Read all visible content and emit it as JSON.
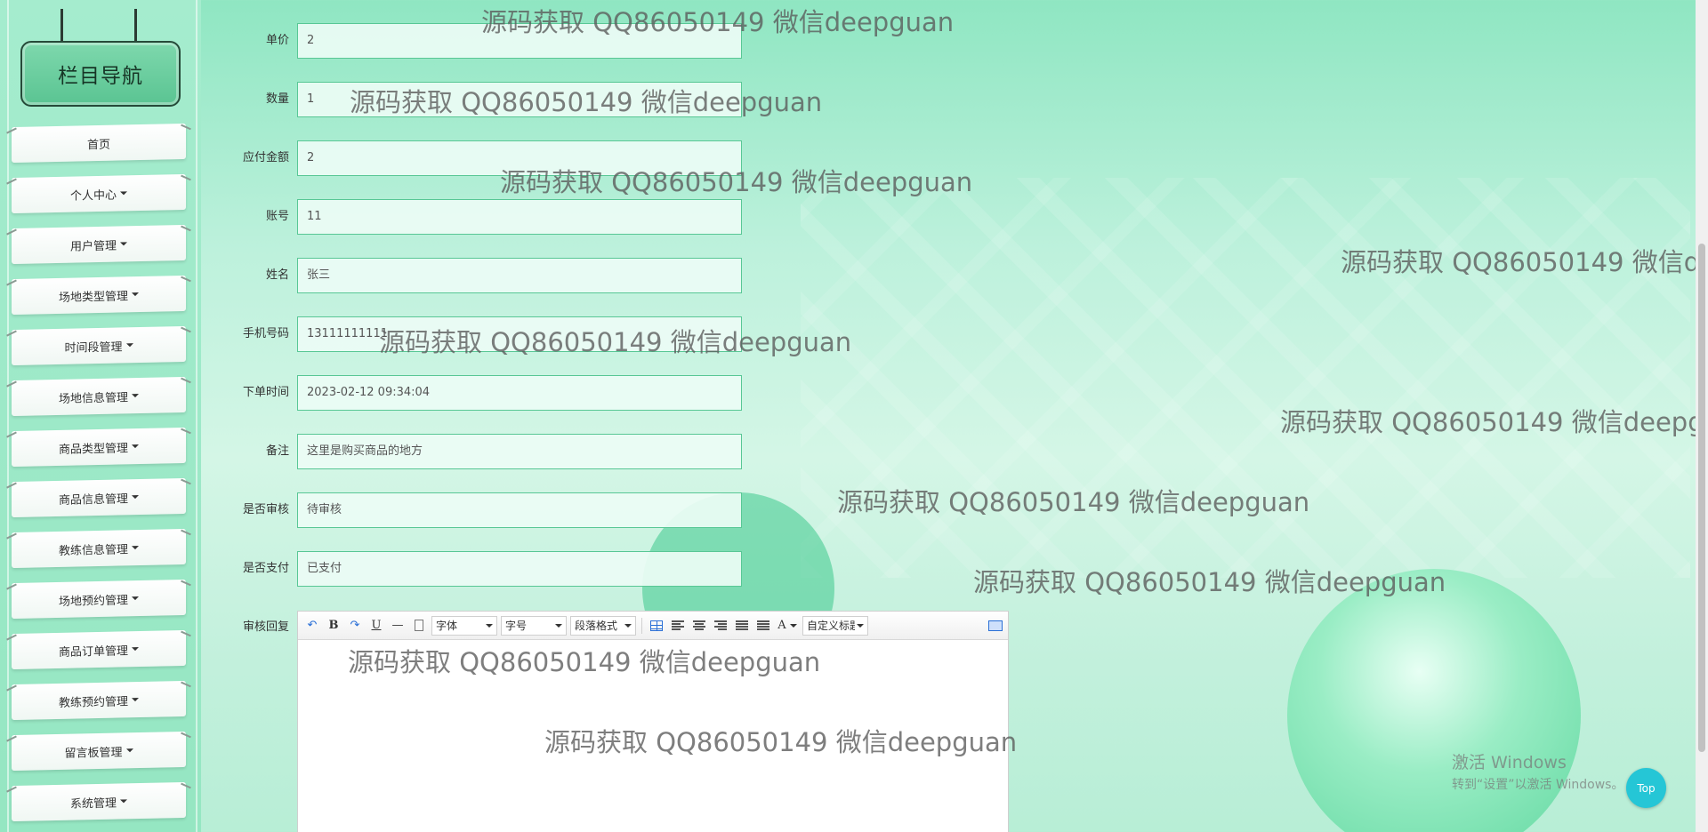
{
  "sidebar": {
    "title": "栏目导航",
    "items": [
      {
        "label": "首页",
        "has_caret": false
      },
      {
        "label": "个人中心",
        "has_caret": true
      },
      {
        "label": "用户管理",
        "has_caret": true
      },
      {
        "label": "场地类型管理",
        "has_caret": true
      },
      {
        "label": "时间段管理",
        "has_caret": true
      },
      {
        "label": "场地信息管理",
        "has_caret": true
      },
      {
        "label": "商品类型管理",
        "has_caret": true
      },
      {
        "label": "商品信息管理",
        "has_caret": true
      },
      {
        "label": "教练信息管理",
        "has_caret": true
      },
      {
        "label": "场地预约管理",
        "has_caret": true
      },
      {
        "label": "商品订单管理",
        "has_caret": true
      },
      {
        "label": "教练预约管理",
        "has_caret": true
      },
      {
        "label": "留言板管理",
        "has_caret": true
      },
      {
        "label": "系统管理",
        "has_caret": true
      }
    ]
  },
  "form": {
    "fields": [
      {
        "label": "单价",
        "value": "2"
      },
      {
        "label": "数量",
        "value": "1"
      },
      {
        "label": "应付金额",
        "value": "2"
      },
      {
        "label": "账号",
        "value": "11"
      },
      {
        "label": "姓名",
        "value": "张三"
      },
      {
        "label": "手机号码",
        "value": "13111111111"
      },
      {
        "label": "下单时间",
        "value": "2023-02-12 09:34:04"
      },
      {
        "label": "备注",
        "value": "这里是购买商品的地方"
      },
      {
        "label": "是否审核",
        "value": "待审核"
      },
      {
        "label": "是否支付",
        "value": "已支付"
      }
    ],
    "editor_label": "审核回复"
  },
  "editor": {
    "font_family_label": "字体",
    "font_size_label": "字号",
    "paragraph_label": "段落格式",
    "custom_heading_label": "自定义标题",
    "bold": "B",
    "underline": "U",
    "font_color": "A"
  },
  "watermark_text": "源码获取 QQ86050149 微信deepguan",
  "windows": {
    "line1": "激活 Windows",
    "line2": "转到“设置”以激活 Windows。"
  },
  "top_button_label": "Top",
  "colors": {
    "accent": "#58c795",
    "top_button": "#25c6d6"
  }
}
